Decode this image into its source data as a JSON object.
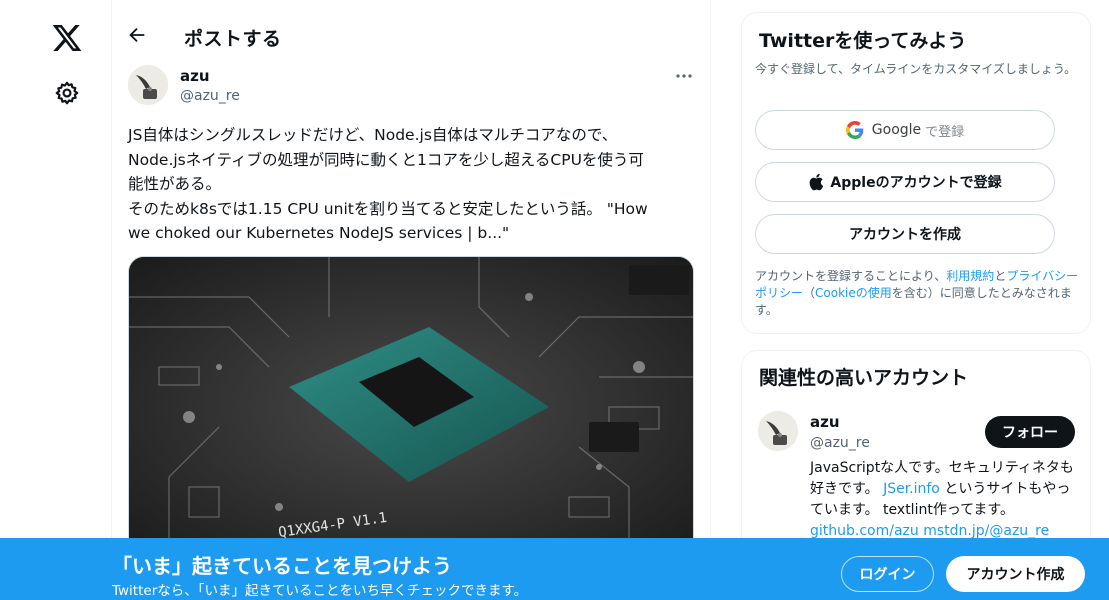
{
  "nav": {
    "logo_icon": "x-logo-icon",
    "settings_icon": "gear-icon"
  },
  "header": {
    "title": "ポストする",
    "back_icon": "arrow-left-icon"
  },
  "tweet": {
    "author_name": "azu",
    "author_handle": "@azu_re",
    "more_icon": "more-horizontal-icon",
    "text_lines": [
      "JS自体はシングルスレッドだけど、Node.js自体はマルチコアなので、",
      "Node.jsネイティブの処理が同時に動くと1コアを少し超えるCPUを使う可",
      "能性がある。",
      "そのためk8sでは1.15 CPU unitを割り当てると安定したという話。 \"How",
      "we choked our Kubernetes NodeJS services | b...\""
    ],
    "media_label": "Q1XXG4-P V1.1"
  },
  "signup": {
    "title": "Twitterを使ってみよう",
    "subtitle": "今すぐ登録して、タイムラインをカスタマイズしましょう。",
    "google_label": "Google",
    "google_suffix": "で登録",
    "apple_label": "Appleのアカウントで登録",
    "create_label": "アカウントを作成",
    "legal_prefix": "アカウントを登録することにより、",
    "legal_terms": "利用規約",
    "legal_and": "と",
    "legal_privacy": "プライバシーポリシー",
    "legal_paren_open": "（",
    "legal_cookie": "Cookieの使用",
    "legal_paren_close": "を含む）に同意したとみなされます。"
  },
  "related": {
    "title": "関連性の高いアカウント",
    "name": "azu",
    "handle": "@azu_re",
    "follow_label": "フォロー",
    "bio_text": "JavaScriptな人です。セキュリティネタも好きです。",
    "bio_link1": "JSer.info",
    "bio_mid": " というサイトもやっています。 textlint作ってます。",
    "bio_link2": "github.com/azu",
    "bio_link3": "mstdn.jp/@azu_re"
  },
  "banner": {
    "title": "「いま」起きていることを見つけよう",
    "subtitle": "Twitterなら、「いま」起きていることをいち早くチェックできます。",
    "login_label": "ログイン",
    "signup_label": "アカウント作成"
  },
  "colors": {
    "accent": "#1d9bf0",
    "text": "#0f1419",
    "muted": "#536471",
    "border": "#eff3f4"
  }
}
